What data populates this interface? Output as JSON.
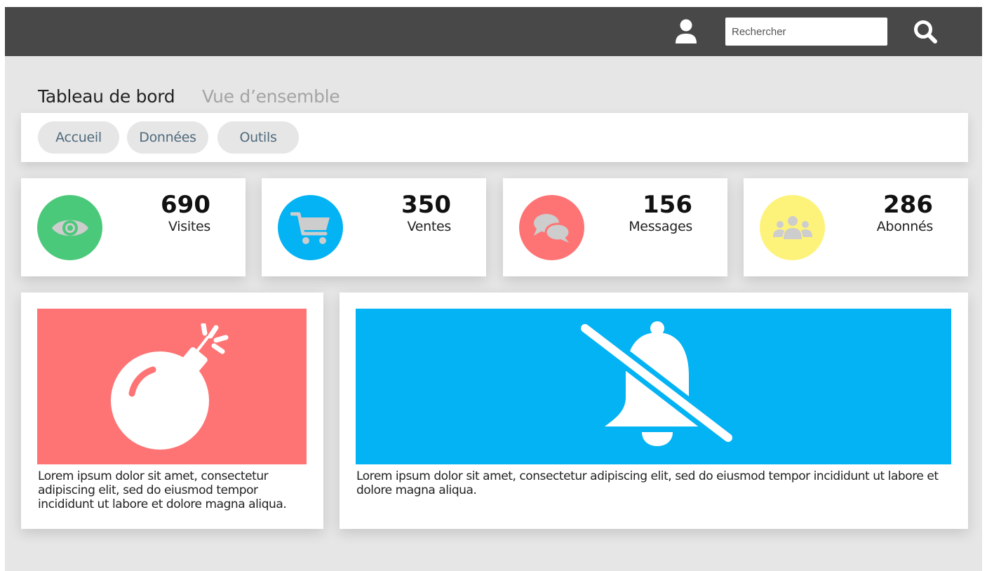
{
  "header": {
    "search_placeholder": "Rechercher",
    "user_icon": "user-icon",
    "search_icon": "search-icon"
  },
  "page": {
    "title": "Tableau de bord",
    "subtitle": "Vue d’ensemble"
  },
  "nav": {
    "items": [
      {
        "label": "Accueil"
      },
      {
        "label": "Données"
      },
      {
        "label": "Outils"
      }
    ]
  },
  "stats": [
    {
      "value": "690",
      "label": "Visites",
      "icon": "eye-icon",
      "color": "#4bc97a"
    },
    {
      "value": "350",
      "label": "Ventes",
      "icon": "cart-icon",
      "color": "#03b3f3"
    },
    {
      "value": "156",
      "label": "Messages",
      "icon": "chat-icon",
      "color": "#fe7474"
    },
    {
      "value": "286",
      "label": "Abonnés",
      "icon": "users-icon",
      "color": "#fef37a"
    }
  ],
  "cards": [
    {
      "icon": "bomb-icon",
      "color": "#fe7474",
      "text": "Lorem ipsum dolor sit amet, consectetur adipiscing elit, sed do eiusmod tempor incididunt ut labore et dolore magna aliqua."
    },
    {
      "icon": "bell-slash-icon",
      "color": "#03b3f3",
      "text": "Lorem ipsum dolor sit amet, consectetur adipiscing elit, sed do eiusmod tempor incididunt ut labore et dolore magna aliqua."
    }
  ],
  "colors": {
    "topbar": "#484848",
    "background": "#e6e6e6",
    "pill": "#e6e6e6",
    "pill_text": "#4f6a7c",
    "stat_icon_glyph": "#cdcdcd"
  }
}
